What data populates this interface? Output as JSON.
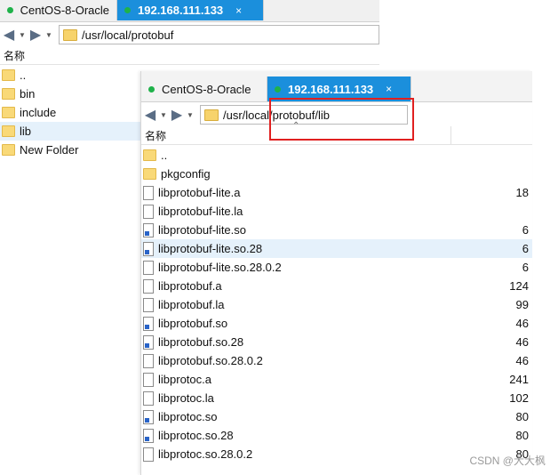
{
  "back": {
    "tabs": [
      {
        "label": "CentOS-8-Oracle",
        "active": false
      },
      {
        "label": "192.168.111.133",
        "active": true,
        "close": "×"
      }
    ],
    "path": "/usr/local/protobuf",
    "column_name": "名称",
    "rows": [
      {
        "name": "..",
        "kind": "folder"
      },
      {
        "name": "bin",
        "kind": "folder"
      },
      {
        "name": "include",
        "kind": "folder"
      },
      {
        "name": "lib",
        "kind": "folder",
        "selected": true
      },
      {
        "name": "New Folder",
        "kind": "folder"
      }
    ]
  },
  "front": {
    "tabs": [
      {
        "label": "CentOS-8-Oracle",
        "active": false
      },
      {
        "label": "192.168.111.133",
        "active": true,
        "close": "×"
      }
    ],
    "path": "/usr/local/protobuf/lib",
    "column_name": "名称",
    "rows": [
      {
        "name": "..",
        "kind": "folder",
        "size": ""
      },
      {
        "name": "pkgconfig",
        "kind": "folder",
        "size": ""
      },
      {
        "name": "libprotobuf-lite.a",
        "kind": "file",
        "size": "18"
      },
      {
        "name": "libprotobuf-lite.la",
        "kind": "file",
        "size": ""
      },
      {
        "name": "libprotobuf-lite.so",
        "kind": "link",
        "size": "6"
      },
      {
        "name": "libprotobuf-lite.so.28",
        "kind": "link",
        "size": "6",
        "selected": true
      },
      {
        "name": "libprotobuf-lite.so.28.0.2",
        "kind": "file",
        "size": "6"
      },
      {
        "name": "libprotobuf.a",
        "kind": "file",
        "size": "124"
      },
      {
        "name": "libprotobuf.la",
        "kind": "file",
        "size": "99"
      },
      {
        "name": "libprotobuf.so",
        "kind": "link",
        "size": "46"
      },
      {
        "name": "libprotobuf.so.28",
        "kind": "link",
        "size": "46"
      },
      {
        "name": "libprotobuf.so.28.0.2",
        "kind": "file",
        "size": "46"
      },
      {
        "name": "libprotoc.a",
        "kind": "file",
        "size": "241"
      },
      {
        "name": "libprotoc.la",
        "kind": "file",
        "size": "102"
      },
      {
        "name": "libprotoc.so",
        "kind": "link",
        "size": "80"
      },
      {
        "name": "libprotoc.so.28",
        "kind": "link",
        "size": "80"
      },
      {
        "name": "libprotoc.so.28.0.2",
        "kind": "file",
        "size": "80"
      }
    ]
  },
  "watermark": "CSDN @大大枫",
  "colors": {
    "tab_active": "#1b8fdc",
    "status_dot": "#1fb24a",
    "highlight_box": "#e02020"
  }
}
